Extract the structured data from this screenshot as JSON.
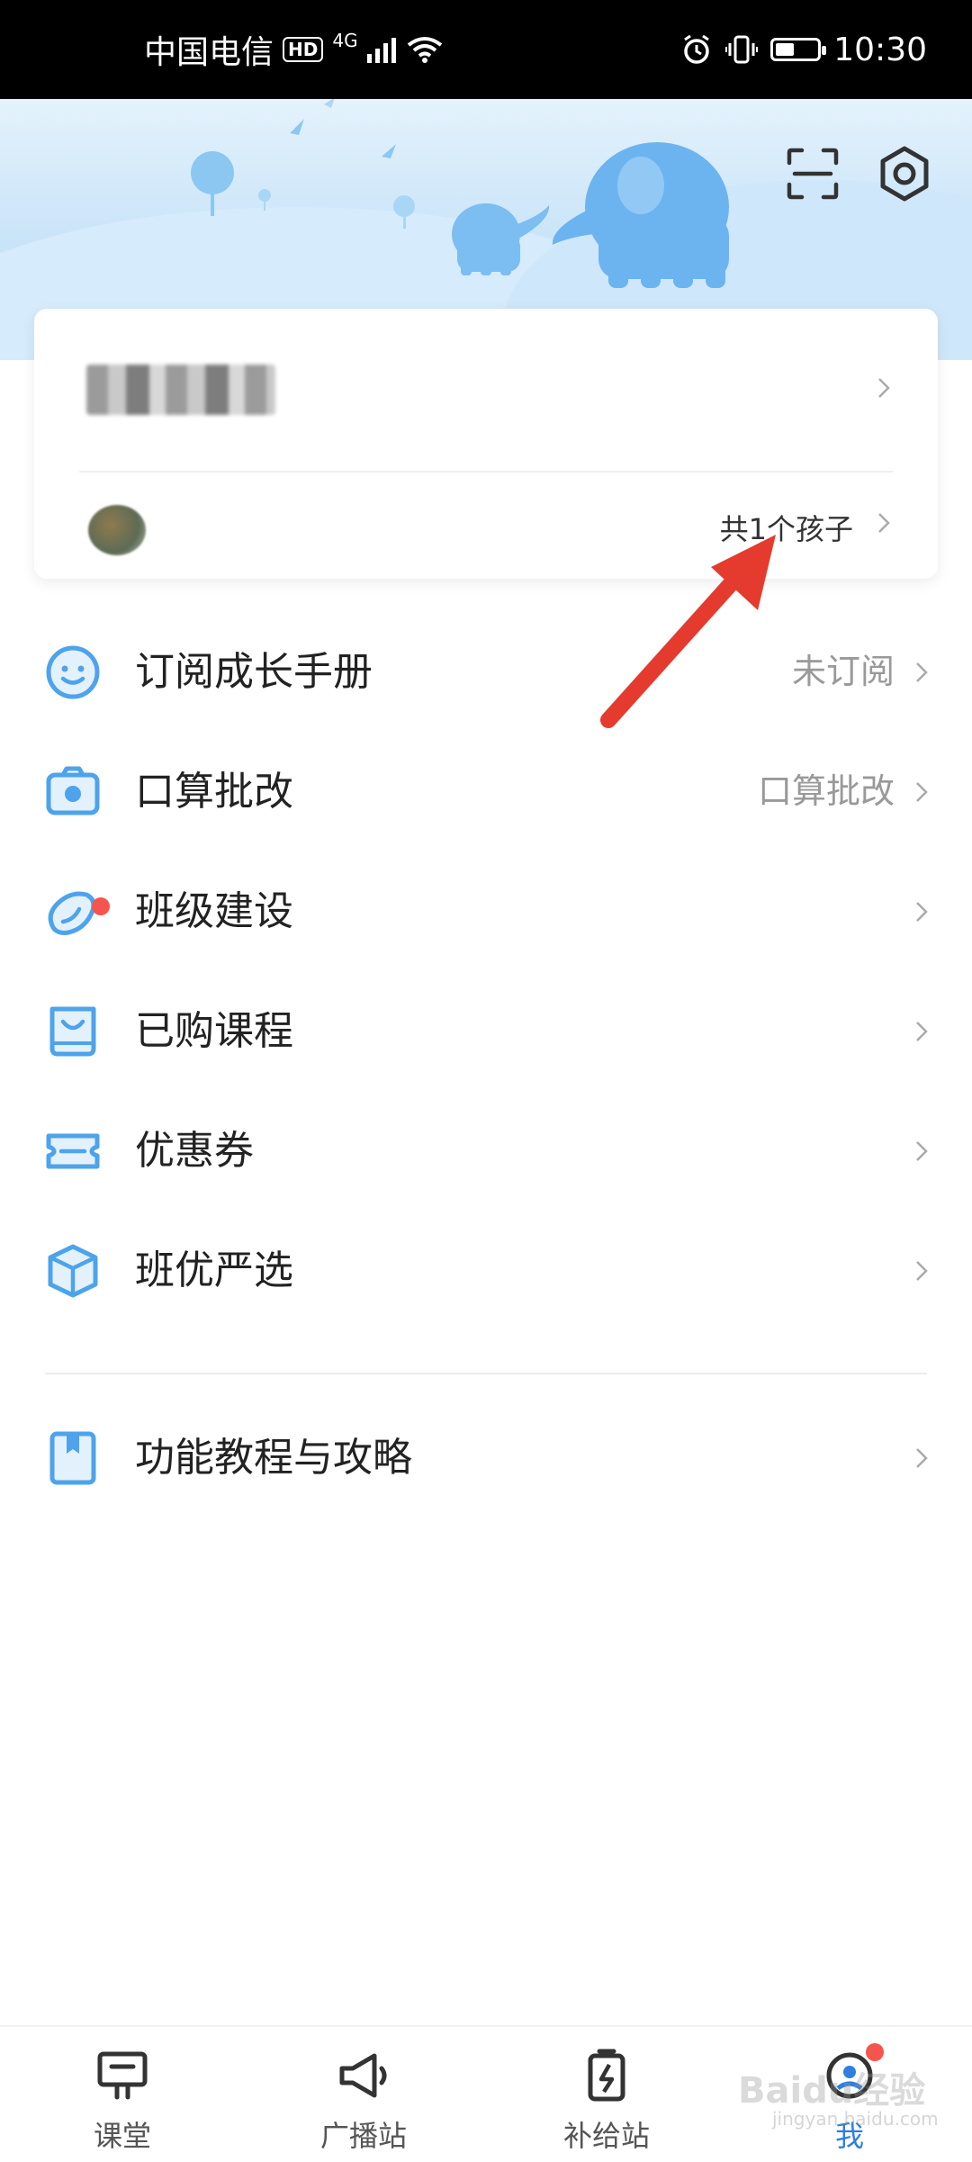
{
  "status_bar": {
    "carrier": "中国电信",
    "hd": "HD",
    "network": "4G",
    "time": "10:30",
    "battery_level": 0.45
  },
  "header": {
    "scan_icon": "scan-icon",
    "settings_icon": "settings-icon"
  },
  "profile": {
    "child_count": "共1个孩子"
  },
  "menu": [
    {
      "label": "订阅成长手册",
      "value": "未订阅",
      "icon": "smiley-icon"
    },
    {
      "label": "口算批改",
      "value": "口算批改",
      "icon": "camera-icon"
    },
    {
      "label": "班级建设",
      "value": "",
      "icon": "bean-icon"
    },
    {
      "label": "已购课程",
      "value": "",
      "icon": "shopping-bag-icon"
    },
    {
      "label": "优惠券",
      "value": "",
      "icon": "coupon-icon"
    },
    {
      "label": "班优严选",
      "value": "",
      "icon": "box-icon"
    },
    {
      "label": "功能教程与攻略",
      "value": "",
      "icon": "bookmark-book-icon"
    }
  ],
  "bottom_nav": [
    {
      "label": "课堂",
      "icon": "classroom-icon"
    },
    {
      "label": "广播站",
      "icon": "megaphone-icon"
    },
    {
      "label": "补给站",
      "icon": "battery-charge-icon"
    },
    {
      "label": "我",
      "icon": "profile-icon",
      "active": true
    }
  ],
  "watermark": {
    "text": "Baidu经验",
    "sub": "jingyan.baidu.com"
  },
  "colors": {
    "accent": "#2d7fe0",
    "icon_blue": "#4da3ec",
    "badge_red": "#f5554c",
    "arrow_red": "#e53b2e"
  }
}
